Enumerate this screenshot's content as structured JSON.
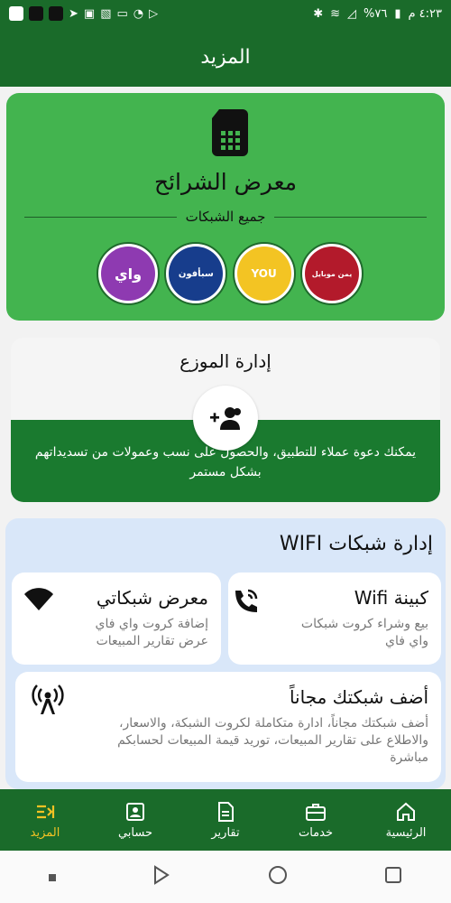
{
  "statusbar": {
    "time": "٤:٢٣ م",
    "battery": "%٧٦"
  },
  "appbar": {
    "title": "المزيد"
  },
  "sim_card": {
    "title": "معرض الشرائح",
    "subtitle": "جميع الشبكات",
    "logos": [
      {
        "name": "wai",
        "label": "واي",
        "color": "#8e3ab1"
      },
      {
        "name": "sabafon",
        "label": "سبأفون",
        "color": "#173d8c"
      },
      {
        "name": "you",
        "label": "YOU",
        "color": "#f3c423"
      },
      {
        "name": "yemen-mobile",
        "label": "يمن موبايل",
        "color": "#b31a2b"
      }
    ]
  },
  "distributor_card": {
    "title": "إدارة الموزع",
    "description": "يمكنك دعوة عملاء للتطبيق، والحصول على نسب وعمولات من تسديداتهم بشكل مستمر"
  },
  "wifi_section": {
    "title": "إدارة شبكات WIFI",
    "tiles": [
      {
        "title": "كبينة Wifi",
        "desc_line1": "بيع وشراء كروت شبكات",
        "desc_line2": "واي فاي",
        "icon": "phone-call-icon"
      },
      {
        "title": "معرض شبكاتي",
        "desc_line1": "إضافة كروت واي فاي",
        "desc_line2": "عرض تقارير المبيعات",
        "icon": "wifi-icon"
      },
      {
        "title": "أضف شبكتك مجاناً",
        "desc_line1": "أضف شبكتك مجاناً، ادارة متكاملة لكروت الشبكة، والاسعار،",
        "desc_line2": "والاطلاع على تقارير المبيعات، توريد قيمة المبيعات لحسابكم",
        "desc_line3": "مباشرة",
        "icon": "broadcast-antenna-icon"
      }
    ]
  },
  "bottom_nav": {
    "items": [
      {
        "label": "المزيد",
        "icon": "more-icon",
        "active": true
      },
      {
        "label": "حسابي",
        "icon": "account-icon"
      },
      {
        "label": "تقارير",
        "icon": "reports-icon"
      },
      {
        "label": "خدمات",
        "icon": "services-icon"
      },
      {
        "label": "الرئيسية",
        "icon": "home-icon"
      }
    ]
  },
  "colors": {
    "primary": "#1a6b2a",
    "card_green": "#43b44f",
    "dist_green": "#1a7a2f",
    "active_nav": "#f2c224",
    "wifi_bg": "#d9e7f9"
  }
}
